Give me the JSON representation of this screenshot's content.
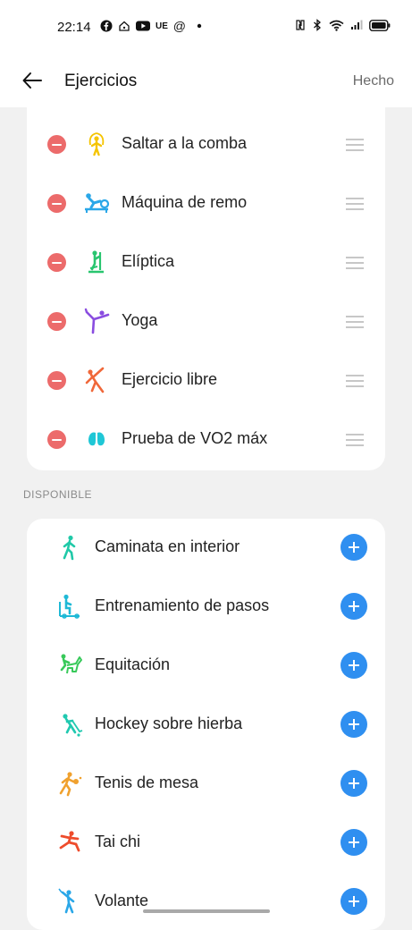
{
  "status_bar": {
    "time": "22:14",
    "carrier_badge": "UE",
    "at_icon": "@"
  },
  "header": {
    "title": "Ejercicios",
    "done_label": "Hecho"
  },
  "selected_exercises": [
    {
      "label": "Saltar a la comba",
      "icon": "jump-rope-icon",
      "color": "#f5c400"
    },
    {
      "label": "Máquina de remo",
      "icon": "rowing-machine-icon",
      "color": "#2aa7e8"
    },
    {
      "label": "Elíptica",
      "icon": "elliptical-icon",
      "color": "#29c56f"
    },
    {
      "label": "Yoga",
      "icon": "yoga-icon",
      "color": "#8a4de0"
    },
    {
      "label": "Ejercicio libre",
      "icon": "free-exercise-icon",
      "color": "#f0683a"
    },
    {
      "label": "Prueba de VO2 máx",
      "icon": "lungs-icon",
      "color": "#1fc7d6"
    }
  ],
  "available_section_label": "DISPONIBLE",
  "available_exercises": [
    {
      "label": "Caminata en interior",
      "icon": "indoor-walk-icon",
      "color": "#20c9a8"
    },
    {
      "label": "Entrenamiento de pasos",
      "icon": "step-training-icon",
      "color": "#1fb9d6"
    },
    {
      "label": "Equitación",
      "icon": "horse-riding-icon",
      "color": "#38c95a"
    },
    {
      "label": "Hockey sobre hierba",
      "icon": "field-hockey-icon",
      "color": "#20c9b0"
    },
    {
      "label": "Tenis de mesa",
      "icon": "table-tennis-icon",
      "color": "#f0a12e"
    },
    {
      "label": "Tai chi",
      "icon": "tai-chi-icon",
      "color": "#ee4c2c"
    },
    {
      "label": "Volante",
      "icon": "badminton-icon",
      "color": "#2aa7e8"
    }
  ]
}
